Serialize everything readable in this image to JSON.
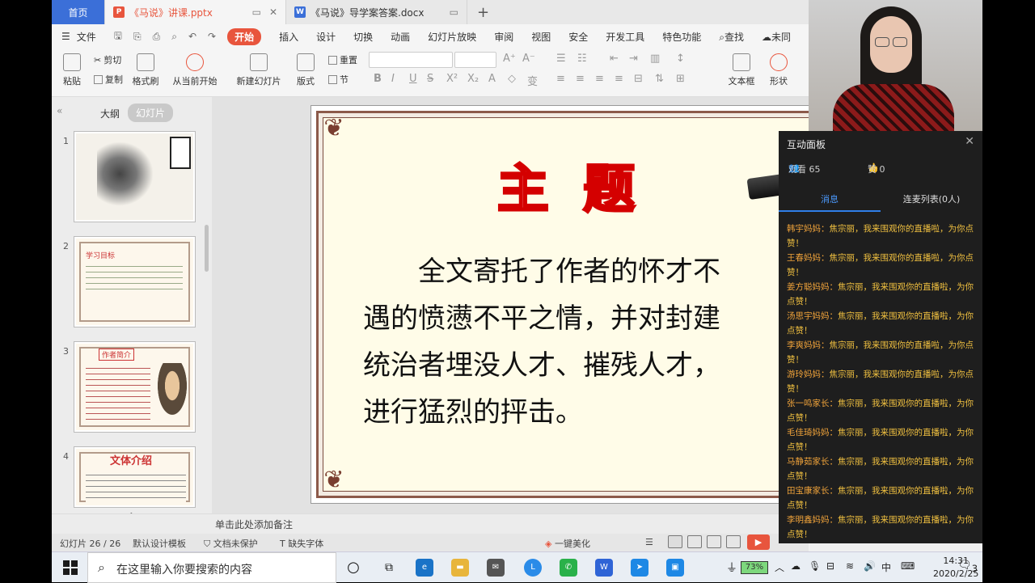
{
  "tabs": {
    "home": "首页",
    "active": "《马说》讲课.pptx",
    "doc": "《马说》导学案答案.docx",
    "add": "+"
  },
  "menu": {
    "file": "文件",
    "items": [
      "开始",
      "插入",
      "设计",
      "切换",
      "动画",
      "幻灯片放映",
      "审阅",
      "视图",
      "安全",
      "开发工具",
      "特色功能"
    ],
    "search": "查找",
    "cloud": "未同"
  },
  "ribbon": {
    "paste": "粘贴",
    "cut": "剪切",
    "copy": "复制",
    "format_painter": "格式刷",
    "from_start": "从当前开始",
    "new_slide": "新建幻灯片",
    "layout": "版式",
    "reset": "重置",
    "section": "节",
    "textbox": "文本框",
    "shape": "形状"
  },
  "pane": {
    "outline": "大纲",
    "slides": "幻灯片",
    "numbers": [
      "1",
      "2",
      "3",
      "4"
    ],
    "thumb2_title": "学习目标",
    "thumb3_title": "作者简介",
    "thumb4_title": "文体介绍",
    "add": "+"
  },
  "slide": {
    "title": "主 题",
    "body": "　　全文寄托了作者的怀才不\n遇的愤懑不平之情，并对封建\n统治者埋没人才、摧残人才，\n进行猛烈的抨击。"
  },
  "notes": "单击此处添加备注",
  "status": {
    "slide_count": "幻灯片 26 / 26",
    "template": "默认设计模板",
    "protect": "文档未保护",
    "font": "缺失字体",
    "beautify": "一键美化"
  },
  "panel": {
    "title": "互动面板",
    "viewers": "观看 65",
    "likes": "赞 0",
    "tab_messages": "消息",
    "tab_mic": "连麦列表(0人)",
    "messages": [
      {
        "name": "韩宇妈妈：",
        "text": "焦宗丽，我来围观你的直播啦，为你点赞！"
      },
      {
        "name": "王春妈妈：",
        "text": "焦宗丽，我来围观你的直播啦，为你点赞！"
      },
      {
        "name": "姜方聪妈妈：",
        "text": "焦宗丽，我来围观你的直播啦，为你点赞！"
      },
      {
        "name": "汤思宇妈妈：",
        "text": "焦宗丽，我来围观你的直播啦，为你点赞！"
      },
      {
        "name": "李爽妈妈：",
        "text": "焦宗丽，我来围观你的直播啦，为你点赞！"
      },
      {
        "name": "游玲妈妈：",
        "text": "焦宗丽，我来围观你的直播啦，为你点赞！"
      },
      {
        "name": "张一鸣家长：",
        "text": "焦宗丽，我来围观你的直播啦，为你点赞！"
      },
      {
        "name": "毛佳琦妈妈：",
        "text": "焦宗丽，我来围观你的直播啦，为你点赞！"
      },
      {
        "name": "马静茹家长：",
        "text": "焦宗丽，我来围观你的直播啦，为你点赞！"
      },
      {
        "name": "田宝康家长：",
        "text": "焦宗丽，我来围观你的直播啦，为你点赞！"
      },
      {
        "name": "李明鑫妈妈：",
        "text": "焦宗丽，我来围观你的直播啦，为你点赞！"
      }
    ]
  },
  "taskbar": {
    "search_placeholder": "在这里输入你要搜索的内容",
    "battery": "73%",
    "ime": "中",
    "time": "14:31",
    "date": "2020/2/25",
    "notifications": "3"
  },
  "colors": {
    "accent": "#e8553d",
    "home_tab": "#3b6fd8",
    "slide_title": "#d40000",
    "msg_name": "#f0a33a"
  }
}
